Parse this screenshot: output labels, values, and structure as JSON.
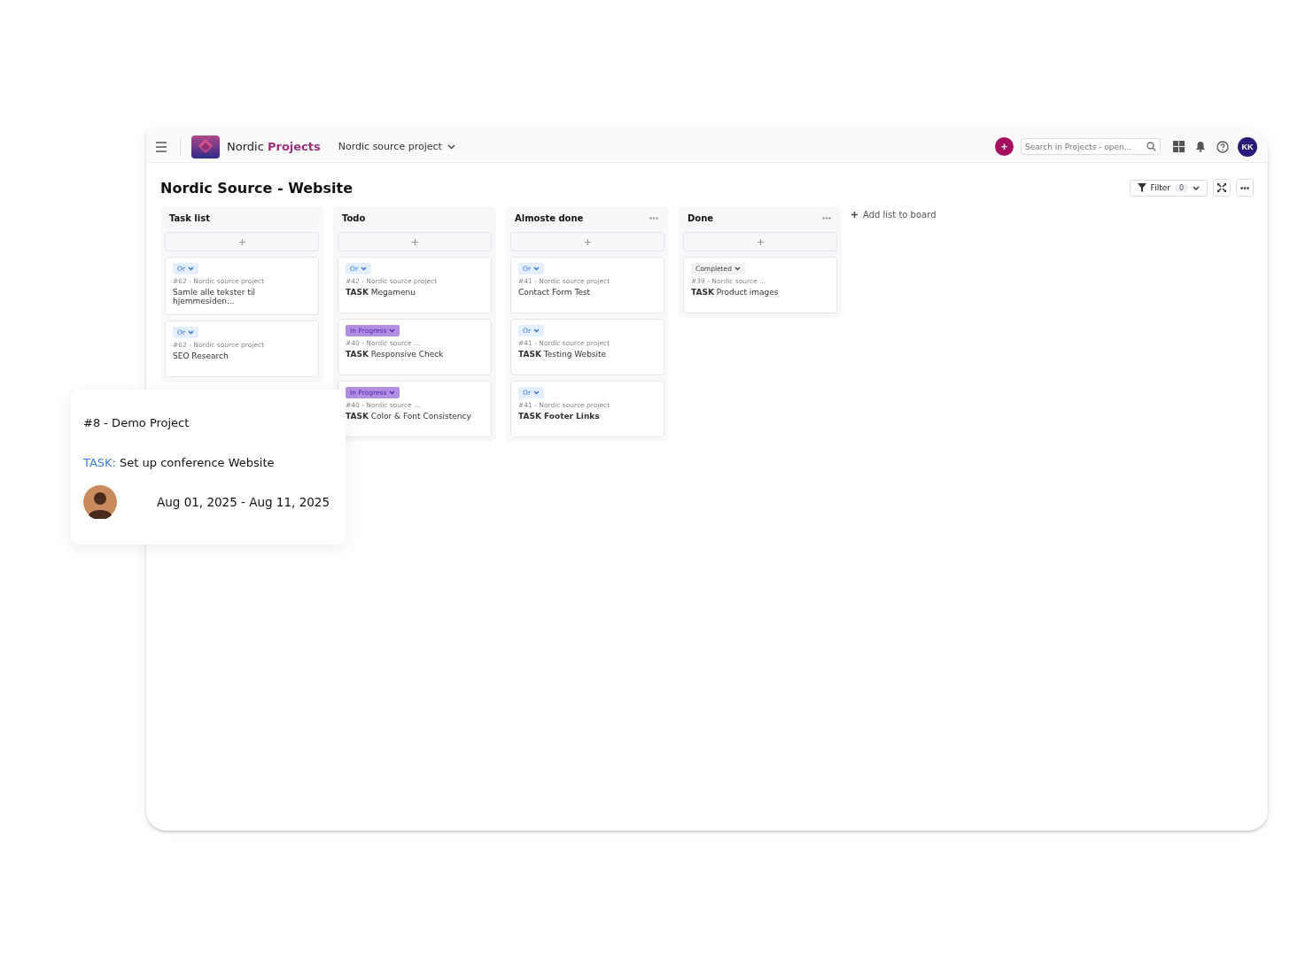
{
  "topbar": {
    "brand_plain": "Nordic ",
    "brand_accent": "Projects",
    "project_switch": "Nordic source project",
    "add_button": "+",
    "search": {
      "placeholder": "Search in Projects - open..."
    },
    "avatar": "KK"
  },
  "board": {
    "title": "Nordic Source - Website",
    "filter": {
      "label": "Filter",
      "count": "0"
    },
    "lists": [
      {
        "title": "Task list",
        "menu": false,
        "cards": [
          {
            "status": "Or",
            "kind": "or",
            "meta": "#62 - Nordic source project",
            "title": "Samle alle tekster til hjemmesiden..."
          },
          {
            "status": "Or",
            "kind": "or",
            "meta": "#62 - Nordic source project",
            "title": "SEO Research"
          }
        ]
      },
      {
        "title": "Todo",
        "menu": false,
        "cards": [
          {
            "status": "Or",
            "kind": "or",
            "meta": "#42 - Nordic source project",
            "title": "**TASK** Megamenu"
          },
          {
            "status": "In Progress",
            "kind": "progress",
            "meta": "#40 - Nordic source ...",
            "title": "**TASK** Responsive Check"
          },
          {
            "status": "In Progress",
            "kind": "progress",
            "meta": "#40 - Nordic source ...",
            "title": "**TASK** Color & Font Consistency"
          }
        ]
      },
      {
        "title": "Almoste done",
        "menu": true,
        "cards": [
          {
            "status": "Or",
            "kind": "or",
            "meta": "#41 - Nordic source project",
            "title": "Contact Form Test"
          },
          {
            "status": "Or",
            "kind": "or",
            "meta": "#41 - Nordic source project",
            "title": "**TASK** Testing Website"
          },
          {
            "status": "Or",
            "kind": "or",
            "meta": "#41 - Nordic source project",
            "title": "**TASK Footer Links**"
          }
        ]
      },
      {
        "title": "Done",
        "menu": true,
        "cards": [
          {
            "status": "Completed",
            "kind": "completed",
            "meta": "#39 - Nordic source ...",
            "title": "**TASK** Product images"
          }
        ]
      }
    ],
    "add_list": "Add list to board"
  },
  "popup": {
    "project": "#8 - Demo Project",
    "task_label": "TASK:",
    "task": "Set up conference Website",
    "dates": "Aug 01, 2025 - Aug 11, 2025"
  }
}
